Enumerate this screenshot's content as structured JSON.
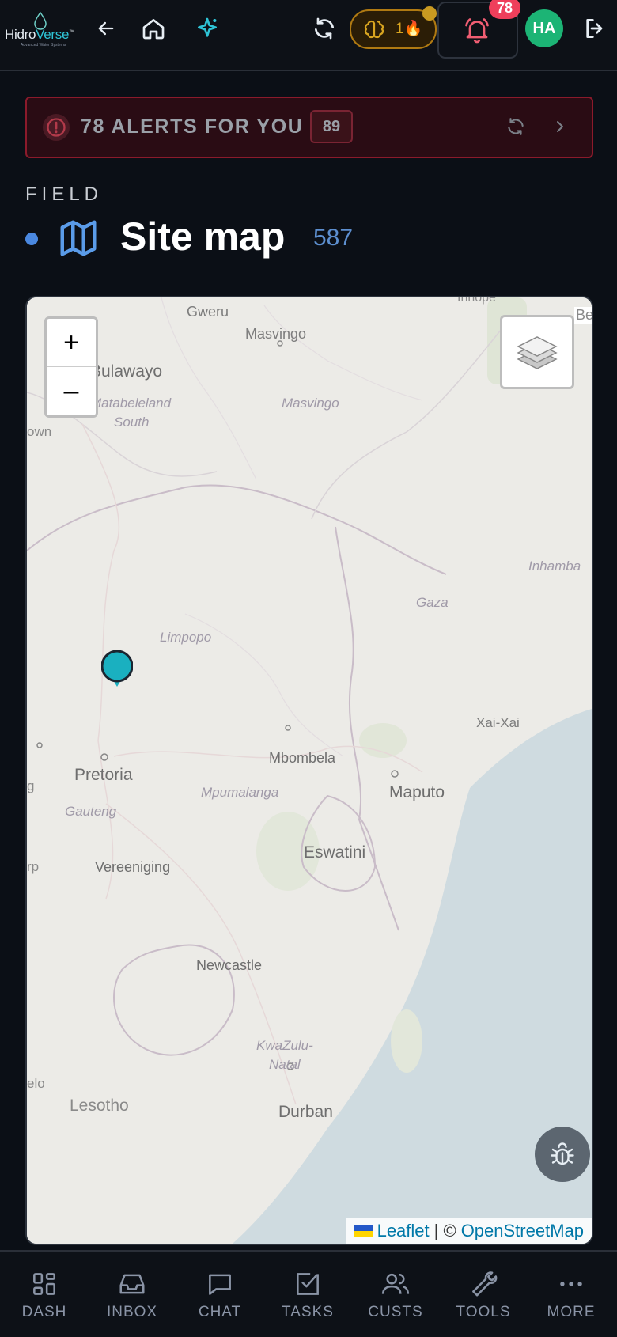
{
  "header": {
    "logo_main": "Hidro",
    "logo_accent": "Verse",
    "logo_tm": "™",
    "logo_sub": "Advanced Water Systems",
    "streak_count": "1🔥",
    "notifications_badge": "78",
    "avatar_initials": "HA"
  },
  "alerts": {
    "text": "78 ALERTS FOR YOU",
    "count": "89"
  },
  "section": {
    "label": "FIELD",
    "title": "Site map",
    "count": "587"
  },
  "map": {
    "zoom_in": "+",
    "zoom_out": "–",
    "attribution_leaflet": "Leaflet",
    "attribution_sep": "| ©",
    "attribution_osm": "OpenStreetMap",
    "labels": {
      "gweru": "Gweru",
      "masvingo_city": "Masvingo",
      "bulawayo": "Bulawayo",
      "matabeleland": "Matabeleland",
      "south": "South",
      "masvingo_prov": "Masvingo",
      "own": "own",
      "inhambane": "Inhamba",
      "be": "Be",
      "inhope": "Inhope",
      "gaza": "Gaza",
      "limpopo": "Limpopo",
      "xai_xai": "Xai-Xai",
      "mbombela": "Mbombela",
      "pretoria": "Pretoria",
      "mpumalanga": "Mpumalanga",
      "maputo": "Maputo",
      "gauteng": "Gauteng",
      "eswatini": "Eswatini",
      "vereeniging": "Vereeniging",
      "rp": "rp",
      "g": "g",
      "newcastle": "Newcastle",
      "kwazulu": "KwaZulu-",
      "natal": "Natal",
      "elo": "elo",
      "lesotho": "Lesotho",
      "durban": "Durban"
    },
    "colors": {
      "land": "#ecebe7",
      "water": "#cfdbe0",
      "marker": "#1ab0c0"
    }
  },
  "nav": [
    {
      "label": "DASH",
      "icon": "grid-icon"
    },
    {
      "label": "INBOX",
      "icon": "inbox-icon"
    },
    {
      "label": "CHAT",
      "icon": "chat-icon"
    },
    {
      "label": "TASKS",
      "icon": "checkbox-icon"
    },
    {
      "label": "CUSTS",
      "icon": "users-icon"
    },
    {
      "label": "TOOLS",
      "icon": "wrench-icon"
    },
    {
      "label": "MORE",
      "icon": "more-icon"
    }
  ]
}
